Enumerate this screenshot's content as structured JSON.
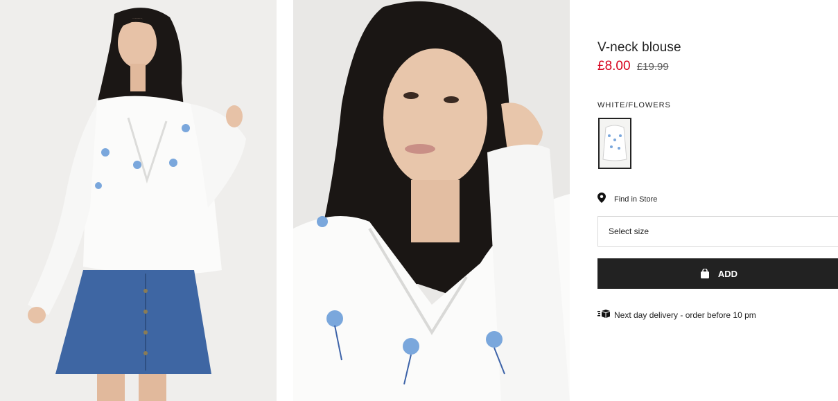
{
  "product": {
    "title": "V-neck blouse",
    "price_sale": "£8.00",
    "price_original": "£19.99",
    "color_label": "WHITE/FLOWERS"
  },
  "actions": {
    "find_in_store": "Find in Store",
    "select_size": "Select size",
    "add_label": "ADD"
  },
  "delivery": {
    "text": "Next day delivery - order before 10 pm"
  },
  "colors": {
    "sale": "#d6001c",
    "button_bg": "#222222",
    "border": "#d9d9d9"
  },
  "icons": {
    "location": "location-pin-icon",
    "bag": "shopping-bag-icon",
    "delivery": "delivery-truck-icon"
  }
}
